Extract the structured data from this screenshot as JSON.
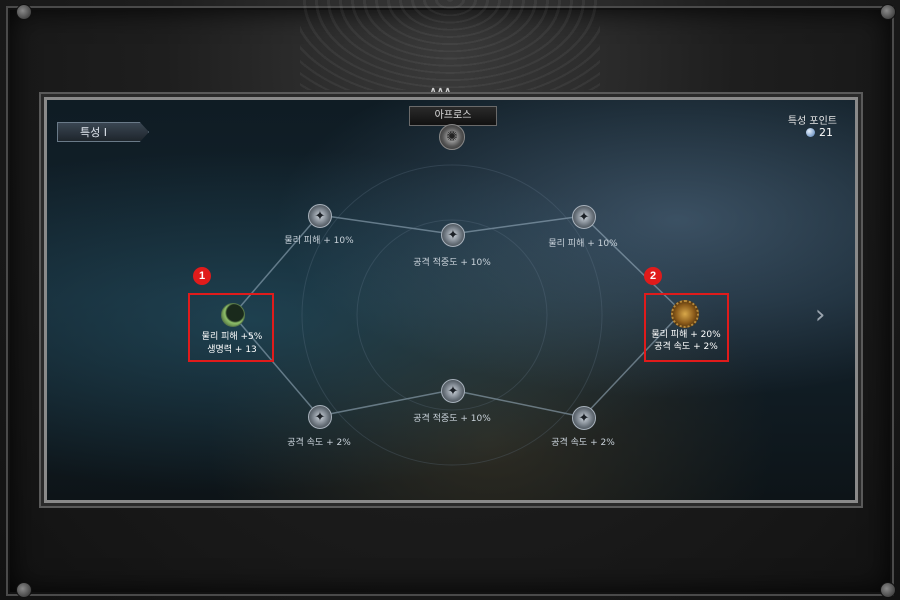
{
  "header": {
    "title": "아프로스"
  },
  "trait_tab": {
    "label": "특성 I"
  },
  "points": {
    "label": "특성 포인트",
    "value": "21"
  },
  "nodes": {
    "top_left": {
      "label": "물리 피해 + 10%"
    },
    "top_center": {
      "label": "공격 적중도 + 10%"
    },
    "top_right": {
      "label": "물리 피해 + 10%"
    },
    "bottom_left": {
      "label": "공격 속도 + 2%"
    },
    "bottom_center": {
      "label": "공격 적중도 + 10%"
    },
    "bottom_right": {
      "label": "공격 속도 + 2%"
    }
  },
  "callouts": {
    "left": {
      "badge": "1",
      "line1": "물리 피해 +5%",
      "line2": "생명력 + 13"
    },
    "right": {
      "badge": "2",
      "line1": "물리 피해 + 20%",
      "line2": "공격 속도 + 2%"
    }
  },
  "icons": {
    "node": "shuriken-icon",
    "moon": "moon-icon",
    "sun": "sun-icon",
    "emblem": "tree-emblem-icon",
    "next": "chevron-right-icon",
    "points": "orb-icon"
  },
  "colors": {
    "highlight": "#e01b1b",
    "panel_border": "#8a8a8a"
  }
}
